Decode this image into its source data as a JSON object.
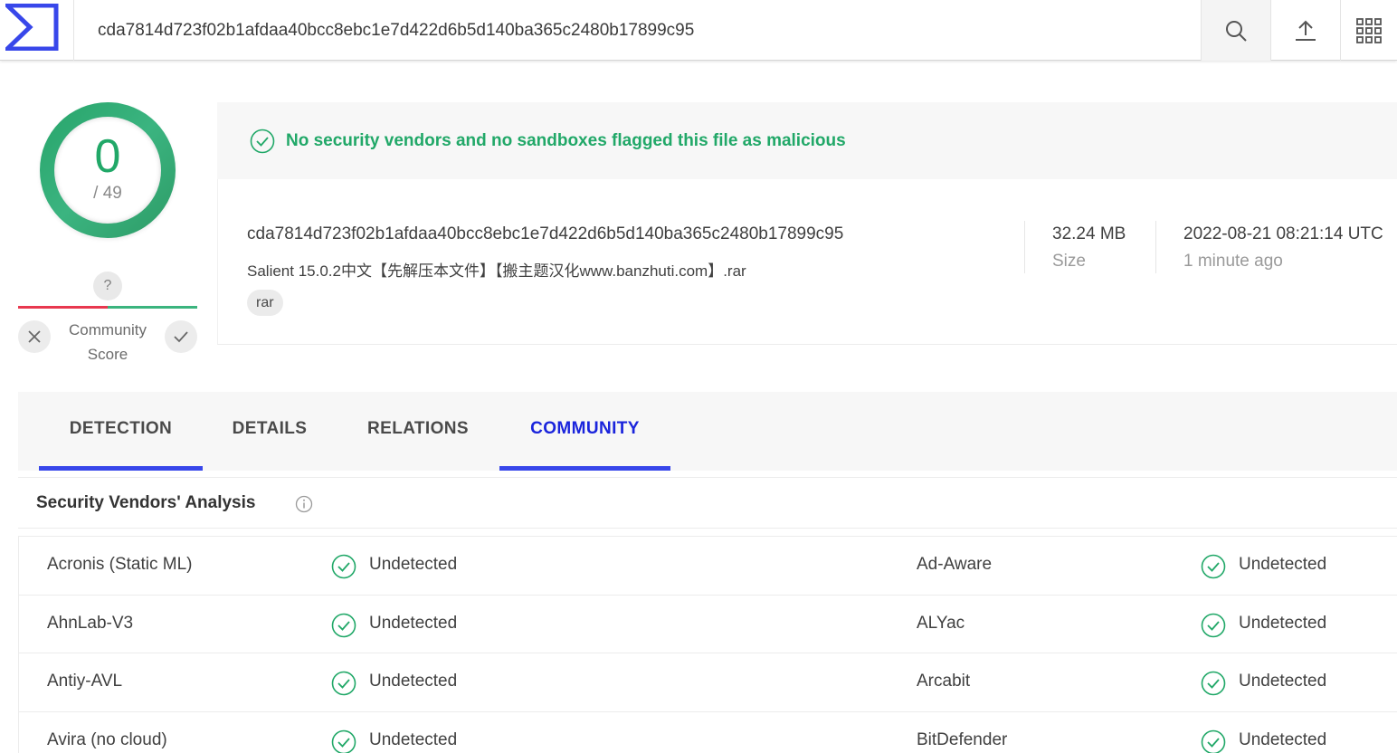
{
  "topbar": {
    "logo": "virustotal-logo",
    "search_value": "cda7814d723f02b1afdaa40bcc8ebc1e7d422d6b5d140ba365c2480b17899c95",
    "icons": [
      "search-icon",
      "upload-icon",
      "apps-grid-icon"
    ]
  },
  "score": {
    "detections": "0",
    "total": "/ 49",
    "community_question": "?",
    "community_label_line1": "Community",
    "community_label_line2": "Score"
  },
  "banner": {
    "message": "No security vendors and no sandboxes flagged this file as malicious",
    "color": "#21a868"
  },
  "file": {
    "hash": "cda7814d723f02b1afdaa40bcc8ebc1e7d422d6b5d140ba365c2480b17899c95",
    "name": "Salient 15.0.2中文【先解压本文件】【搬主题汉化www.banzhuti.com】.rar",
    "tag": "rar",
    "size": "32.24 MB",
    "size_label": "Size",
    "date": "2022-08-21 08:21:14 UTC",
    "date_relative": "1 minute ago"
  },
  "tabs": [
    {
      "label": "DETECTION"
    },
    {
      "label": "DETAILS"
    },
    {
      "label": "RELATIONS"
    },
    {
      "label": "COMMUNITY"
    }
  ],
  "vendors": {
    "title": "Security Vendors' Analysis",
    "rows": [
      {
        "left_name": "Acronis (Static ML)",
        "left_result": "Undetected",
        "right_name": "Ad-Aware",
        "right_result": "Undetected"
      },
      {
        "left_name": "AhnLab-V3",
        "left_result": "Undetected",
        "right_name": "ALYac",
        "right_result": "Undetected"
      },
      {
        "left_name": "Antiy-AVL",
        "left_result": "Undetected",
        "right_name": "Arcabit",
        "right_result": "Undetected"
      },
      {
        "left_name": "Avira (no cloud)",
        "left_result": "Undetected",
        "right_name": "BitDefender",
        "right_result": "Undetected"
      }
    ]
  },
  "colors": {
    "accent_blue": "#3847ea",
    "success_green": "#21a868",
    "danger_red": "#e8384f"
  }
}
